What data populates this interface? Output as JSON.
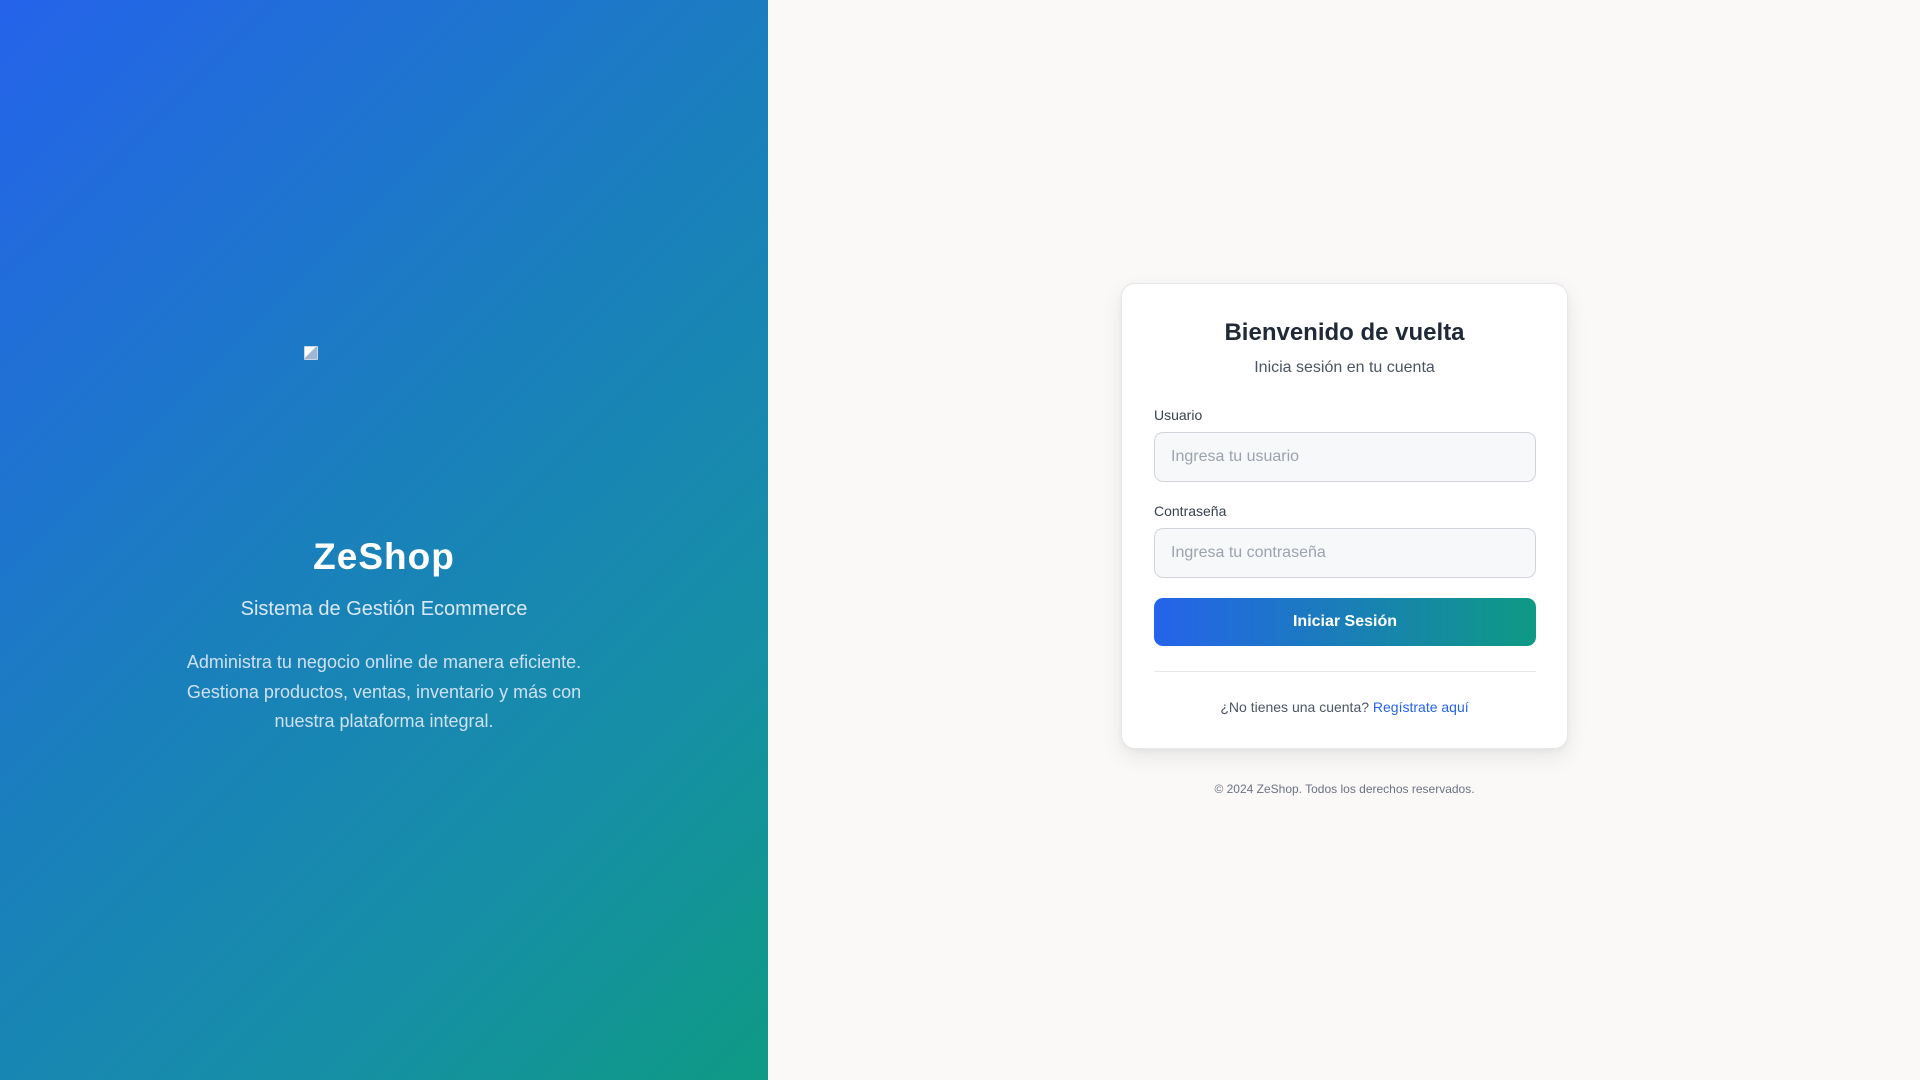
{
  "brand": {
    "logo_icon": "broken-image-icon",
    "name": "ZeShop",
    "tagline": "Sistema de Gestión Ecommerce",
    "description": "Administra tu negocio online de manera eficiente. Gestiona productos, ventas, inventario y más con nuestra plataforma integral.",
    "gradient_start": "#2563eb",
    "gradient_end": "#0e9a84"
  },
  "login": {
    "title": "Bienvenido de vuelta",
    "subtitle": "Inicia sesión en tu cuenta",
    "username": {
      "label": "Usuario",
      "placeholder": "Ingresa tu usuario",
      "value": ""
    },
    "password": {
      "label": "Contraseña",
      "placeholder": "Ingresa tu contraseña",
      "value": ""
    },
    "submit_label": "Iniciar Sesión",
    "register_prompt": "¿No tienes una cuenta?",
    "register_link": "Regístrate aquí",
    "link_color": "#2563eb"
  },
  "footer": {
    "copyright": "© 2024 ZeShop. Todos los derechos reservados."
  }
}
